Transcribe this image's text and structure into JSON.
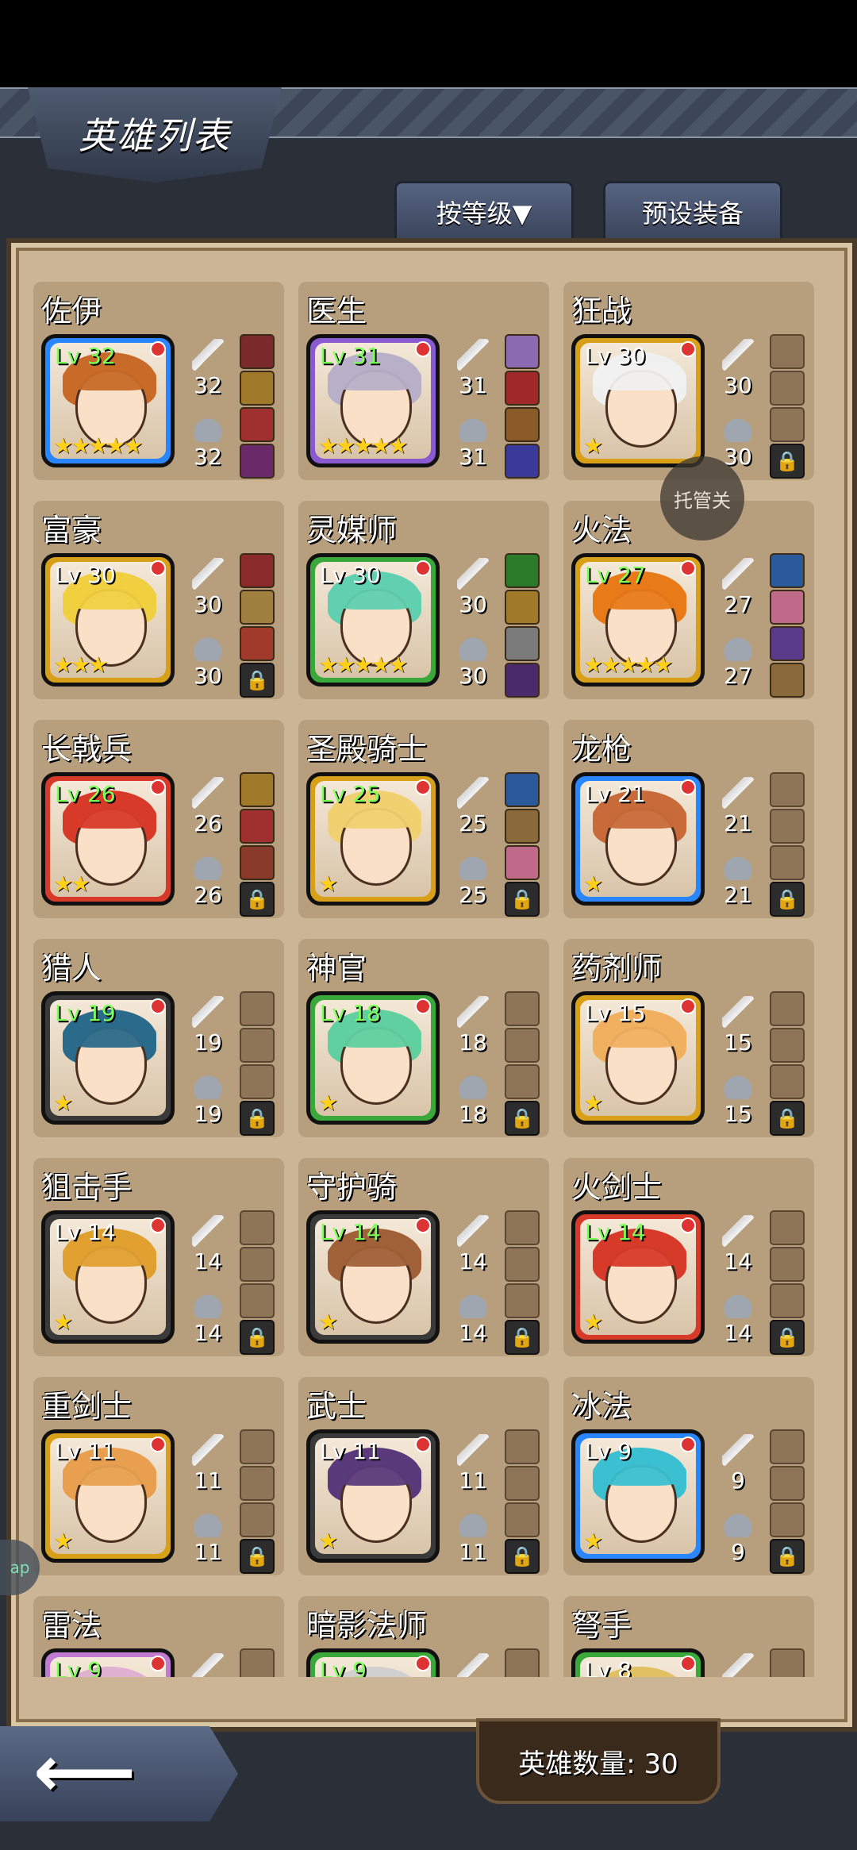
{
  "header": {
    "title": "英雄列表"
  },
  "tabs": {
    "sort_label": "按等级▼",
    "preset_label": "预设装备"
  },
  "overlay": {
    "auto_label": "托管关"
  },
  "side": {
    "pill_label": "ap"
  },
  "footer": {
    "count_label": "英雄数量: 30"
  },
  "heroes": [
    {
      "name": "佐伊",
      "level": "Lv 32",
      "level_color": "#7dff5a",
      "frame": "#2a86ff",
      "hair": "#c86a28",
      "stars": "★★★★★",
      "weapon": "32",
      "armor": "32",
      "slots": [
        "#7a2a2a",
        "#a07a2a",
        "#a03030",
        "#6a2a6a"
      ],
      "locked": false
    },
    {
      "name": "医生",
      "level": "Lv 31",
      "level_color": "#7dff5a",
      "frame": "#8a5ad0",
      "hair": "#b8b0c8",
      "stars": "★★★★★",
      "weapon": "31",
      "armor": "31",
      "slots": [
        "#8a6ab0",
        "#a02828",
        "#8a5a28",
        "#3a3a9a"
      ],
      "locked": false
    },
    {
      "name": "狂战",
      "level": "Lv 30",
      "level_color": "#ffffff",
      "frame": "#d8a018",
      "hair": "#f0f0f0",
      "stars": "★",
      "weapon": "30",
      "armor": "30",
      "slots": [
        "",
        "",
        "",
        ""
      ],
      "locked": true
    },
    {
      "name": "富豪",
      "level": "Lv 30",
      "level_color": "#ffffff",
      "frame": "#d8a018",
      "hair": "#f0d040",
      "stars": "★★★",
      "weapon": "30",
      "armor": "30",
      "slots": [
        "#8a2a2a",
        "#a08040",
        "#a03a2a",
        ""
      ],
      "locked": true
    },
    {
      "name": "灵媒师",
      "level": "Lv 30",
      "level_color": "#ffffff",
      "frame": "#3aa83a",
      "hair": "#60d0b0",
      "stars": "★★★★★",
      "weapon": "30",
      "armor": "30",
      "slots": [
        "#2a7a2a",
        "#a07a2a",
        "#7a7a7a",
        "#4a2a6a"
      ],
      "locked": false
    },
    {
      "name": "火法",
      "level": "Lv 27",
      "level_color": "#7dff5a",
      "frame": "#d8a018",
      "hair": "#e87a18",
      "stars": "★★★★★",
      "weapon": "27",
      "armor": "27",
      "slots": [
        "#2a5a9a",
        "#c06a8a",
        "#5a3a8a",
        "#8a6a3a"
      ],
      "locked": false
    },
    {
      "name": "长戟兵",
      "level": "Lv 26",
      "level_color": "#7dff5a",
      "frame": "#d83a2a",
      "hair": "#d83a2a",
      "stars": "★★",
      "weapon": "26",
      "armor": "26",
      "slots": [
        "#a07a2a",
        "#a03030",
        "#8a3a2a",
        ""
      ],
      "locked": true
    },
    {
      "name": "圣殿骑士",
      "level": "Lv 25",
      "level_color": "#7dff5a",
      "frame": "#d8a018",
      "hair": "#f0d070",
      "stars": "★",
      "weapon": "25",
      "armor": "25",
      "slots": [
        "#2a5a9a",
        "#8a6a3a",
        "#c06a8a",
        ""
      ],
      "locked": true
    },
    {
      "name": "龙枪",
      "level": "Lv 21",
      "level_color": "#ffffff",
      "frame": "#2a86ff",
      "hair": "#c86a3a",
      "stars": "★",
      "weapon": "21",
      "armor": "21",
      "slots": [
        "",
        "",
        "",
        ""
      ],
      "locked": true
    },
    {
      "name": "猎人",
      "level": "Lv 19",
      "level_color": "#7dff5a",
      "frame": "#3a3a3a",
      "hair": "#2a6a8a",
      "stars": "★",
      "weapon": "19",
      "armor": "19",
      "slots": [
        "",
        "",
        "",
        ""
      ],
      "locked": true
    },
    {
      "name": "神官",
      "level": "Lv 18",
      "level_color": "#7dff5a",
      "frame": "#3aa83a",
      "hair": "#60d0a0",
      "stars": "★",
      "weapon": "18",
      "armor": "18",
      "slots": [
        "",
        "",
        "",
        ""
      ],
      "locked": true
    },
    {
      "name": "药剂师",
      "level": "Lv 15",
      "level_color": "#ffffff",
      "frame": "#d8a018",
      "hair": "#f0b060",
      "stars": "★",
      "weapon": "15",
      "armor": "15",
      "slots": [
        "",
        "",
        "",
        ""
      ],
      "locked": true
    },
    {
      "name": "狙击手",
      "level": "Lv 14",
      "level_color": "#ffffff",
      "frame": "#3a3a3a",
      "hair": "#e0a030",
      "stars": "★",
      "weapon": "14",
      "armor": "14",
      "slots": [
        "",
        "",
        "",
        ""
      ],
      "locked": true
    },
    {
      "name": "守护骑",
      "level": "Lv 14",
      "level_color": "#7dff5a",
      "frame": "#3a3a3a",
      "hair": "#a06038",
      "stars": "★",
      "weapon": "14",
      "armor": "14",
      "slots": [
        "",
        "",
        "",
        ""
      ],
      "locked": true
    },
    {
      "name": "火剑士",
      "level": "Lv 14",
      "level_color": "#7dff5a",
      "frame": "#d83a2a",
      "hair": "#d83a2a",
      "stars": "★",
      "weapon": "14",
      "armor": "14",
      "slots": [
        "",
        "",
        "",
        ""
      ],
      "locked": true
    },
    {
      "name": "重剑士",
      "level": "Lv 11",
      "level_color": "#ffffff",
      "frame": "#d8a018",
      "hair": "#e8a050",
      "stars": "★",
      "weapon": "11",
      "armor": "11",
      "slots": [
        "",
        "",
        "",
        ""
      ],
      "locked": true
    },
    {
      "name": "武士",
      "level": "Lv 11",
      "level_color": "#ffffff",
      "frame": "#3a3a3a",
      "hair": "#5a3a7a",
      "stars": "★",
      "weapon": "11",
      "armor": "11",
      "slots": [
        "",
        "",
        "",
        ""
      ],
      "locked": true
    },
    {
      "name": "冰法",
      "level": "Lv 9",
      "level_color": "#ffffff",
      "frame": "#2a86ff",
      "hair": "#3ac0d0",
      "stars": "★",
      "weapon": "9",
      "armor": "9",
      "slots": [
        "",
        "",
        "",
        ""
      ],
      "locked": true
    },
    {
      "name": "雷法",
      "level": "Lv 9",
      "level_color": "#7dff5a",
      "frame": "#c07ad0",
      "hair": "#e0b0d0",
      "stars": "",
      "weapon": "",
      "armor": "",
      "slots": [
        "",
        "",
        "",
        ""
      ],
      "locked": false
    },
    {
      "name": "暗影法师",
      "level": "Lv 9",
      "level_color": "#7dff5a",
      "frame": "#3aa83a",
      "hair": "#d0d0d0",
      "stars": "",
      "weapon": "",
      "armor": "",
      "slots": [
        "",
        "",
        "",
        ""
      ],
      "locked": false
    },
    {
      "name": "弩手",
      "level": "Lv 8",
      "level_color": "#ffffff",
      "frame": "#3aa83a",
      "hair": "#e0c060",
      "stars": "",
      "weapon": "",
      "armor": "",
      "slots": [
        "",
        "",
        "",
        ""
      ],
      "locked": false
    }
  ]
}
